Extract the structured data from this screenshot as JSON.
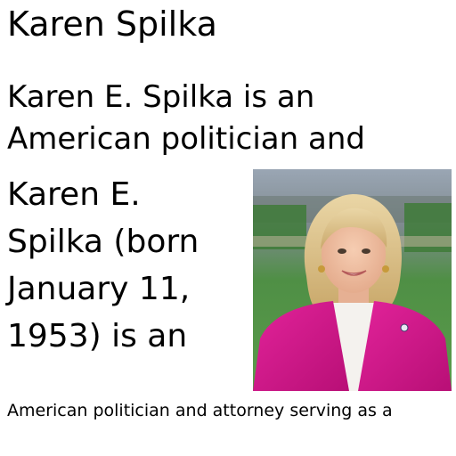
{
  "article": {
    "title": "Karen Spilka",
    "intro_lines": [
      "Karen E. Spilka is an",
      "American politician and"
    ],
    "body_lines": [
      "Karen E.",
      "Spilka (born",
      "January 11,",
      "1953) is an"
    ],
    "continuation": "American politician and attorney serving as a"
  },
  "colors": {
    "text": "#000000",
    "background": "#ffffff",
    "jacket": "#d8188f",
    "backdrop": "#3f8a3a"
  }
}
